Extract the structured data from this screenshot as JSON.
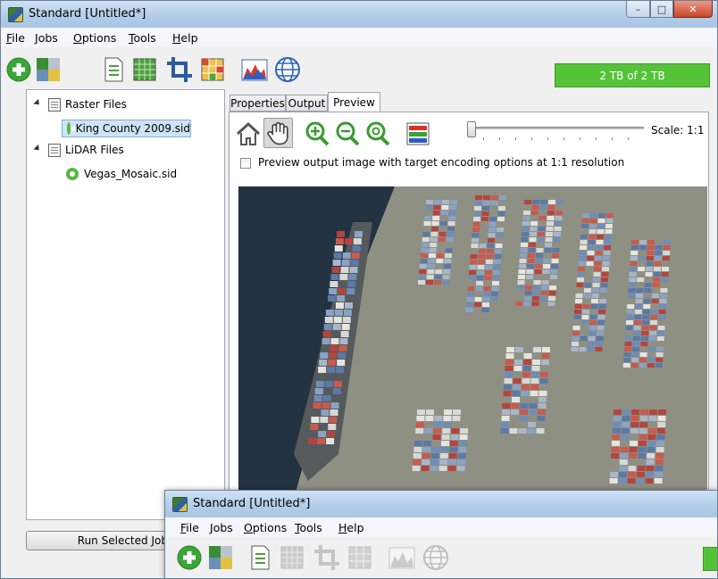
{
  "window": {
    "title": "Standard [Untitled*]",
    "controls": {
      "minimize": "–",
      "maximize": "□",
      "close": "✕"
    }
  },
  "menu": [
    {
      "label": "File",
      "hotkey": "F",
      "rest": "ile"
    },
    {
      "label": "Jobs",
      "hotkey": "J",
      "rest": "obs"
    },
    {
      "label": "Options",
      "hotkey": "O",
      "rest": "ptions"
    },
    {
      "label": "Tools",
      "hotkey": "T",
      "rest": "ools"
    },
    {
      "label": "Help",
      "hotkey": "H",
      "rest": "elp"
    }
  ],
  "toolbar": {
    "icons": [
      "add-icon",
      "mosaic-icon",
      "document-list-icon",
      "grid-icon",
      "crop-icon",
      "color-grid-icon",
      "histogram-icon",
      "globe-icon"
    ],
    "storage_status": "2 TB of 2 TB"
  },
  "tree": {
    "groups": [
      {
        "label": "Raster Files",
        "items": [
          {
            "label": "King County 2009.sid",
            "selected": true
          }
        ]
      },
      {
        "label": "LiDAR Files",
        "items": [
          {
            "label": "Vegas_Mosaic.sid",
            "selected": false
          }
        ]
      }
    ]
  },
  "run_button": "Run Selected Jobs",
  "tabs": [
    {
      "label": "Properties",
      "active": false
    },
    {
      "label": "Output",
      "active": false
    },
    {
      "label": "Preview",
      "active": true
    }
  ],
  "preview": {
    "tools": [
      "home-icon",
      "pan-hand-icon",
      "zoom-in-icon",
      "zoom-out-icon",
      "zoom-fit-icon",
      "bands-icon"
    ],
    "scale_label": "Scale: 1:1",
    "scale_slider": 0.0,
    "checkbox_label": "Preview output image with target encoding options at 1:1 resolution",
    "checkbox_checked": false
  },
  "second_window": {
    "title": "Standard [Untitled*]",
    "menu": [
      {
        "label": "File",
        "hotkey": "F",
        "rest": "ile"
      },
      {
        "label": "Jobs",
        "hotkey": "J",
        "rest": "obs"
      },
      {
        "label": "Options",
        "hotkey": "O",
        "rest": "ptions"
      },
      {
        "label": "Tools",
        "hotkey": "T",
        "rest": "ools"
      },
      {
        "label": "Help",
        "hotkey": "H",
        "rest": "elp"
      }
    ]
  },
  "colors": {
    "status_green": "#55c338",
    "add_green": "#3aa636",
    "selection_bg": "#cde4f7",
    "titlebar": "#b9d1ea"
  }
}
